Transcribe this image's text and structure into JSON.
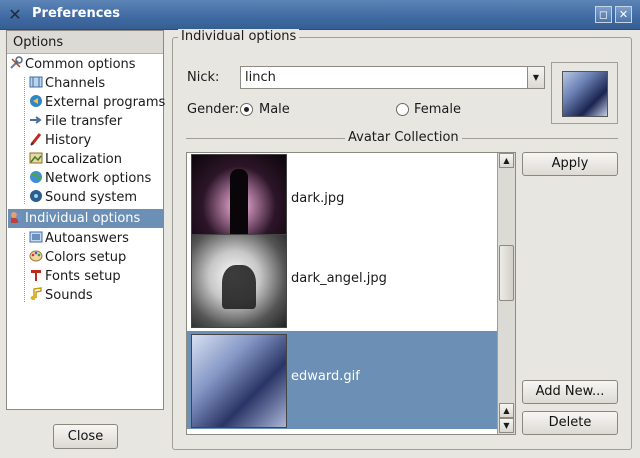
{
  "window": {
    "title": "Preferences",
    "max_glyph": "◻",
    "close_glyph": "✕"
  },
  "options": {
    "header": "Options",
    "items": [
      {
        "label": "Common options",
        "icon": "tools-icon",
        "level": 0
      },
      {
        "label": "Channels",
        "icon": "channels-icon",
        "level": 1
      },
      {
        "label": "External programs",
        "icon": "external-programs-icon",
        "level": 1
      },
      {
        "label": "File transfer",
        "icon": "file-transfer-icon",
        "level": 1
      },
      {
        "label": "History",
        "icon": "history-icon",
        "level": 1
      },
      {
        "label": "Localization",
        "icon": "localization-icon",
        "level": 1
      },
      {
        "label": "Network options",
        "icon": "network-icon",
        "level": 1
      },
      {
        "label": "Sound system",
        "icon": "sound-system-icon",
        "level": 1
      },
      {
        "label": "Individual options",
        "icon": "individual-options-icon",
        "level": 0,
        "selected": true
      },
      {
        "label": "Autoanswers",
        "icon": "autoanswers-icon",
        "level": 1
      },
      {
        "label": "Colors setup",
        "icon": "palette-icon",
        "level": 1
      },
      {
        "label": "Fonts setup",
        "icon": "fonts-icon",
        "level": 1
      },
      {
        "label": "Sounds",
        "icon": "music-note-icon",
        "level": 1
      }
    ],
    "close_label": "Close"
  },
  "individual": {
    "group_title": "Individual options",
    "nick_label": "Nick:",
    "nick_value": "linch",
    "gender_label": "Gender:",
    "gender_options": [
      "Male",
      "Female"
    ],
    "gender_selected": "Male"
  },
  "avatars": {
    "section_title": "Avatar Collection",
    "items": [
      {
        "file": "dark.jpg"
      },
      {
        "file": "dark_angel.jpg"
      },
      {
        "file": "edward.gif",
        "selected": true
      }
    ],
    "apply_label": "Apply",
    "add_new_label": "Add New...",
    "delete_label": "Delete"
  },
  "colors": {
    "selection": "#6b8fb5",
    "titlebar": "#3f6aa2"
  }
}
